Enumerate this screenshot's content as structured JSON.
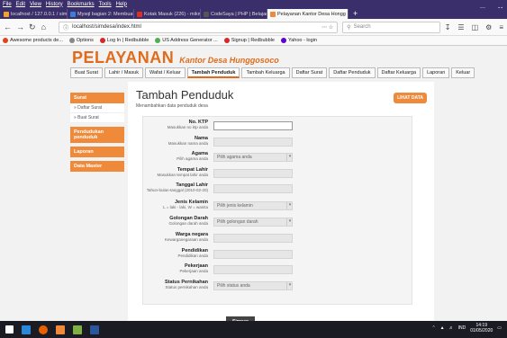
{
  "menu": [
    "File",
    "Edit",
    "View",
    "History",
    "Bookmarks",
    "Tools",
    "Help"
  ],
  "tabs": [
    {
      "label": "localhost / 127.0.0.1 / simdes",
      "color": "#f4a32a",
      "active": false
    },
    {
      "label": "Mysql bagian 2: Membuat ko",
      "color": "#3b7dd8",
      "active": false
    },
    {
      "label": "Kotak Masuk (226) - mikmaki",
      "color": "#d93025",
      "active": false
    },
    {
      "label": "CodeSaya | PHP | Belajar",
      "color": "#555555",
      "active": false
    },
    {
      "label": "Pelayanan Kantor Desa Hongg",
      "color": "#ef8a3a",
      "active": true
    }
  ],
  "url": "localhost/simdesa/index.html",
  "search_placeholder": "Search",
  "bookmarks": [
    {
      "label": "Awesome products de...",
      "color": "#e0441b"
    },
    {
      "label": "Options",
      "color": "#888888"
    },
    {
      "label": "Log In | Redbubble",
      "color": "#d62828"
    },
    {
      "label": "US Address Generator ...",
      "color": "#4caf50"
    },
    {
      "label": "Signup | Redbubble",
      "color": "#d62828"
    },
    {
      "label": "Yahoo - login",
      "color": "#6001d2"
    }
  ],
  "site": {
    "title": "PELAYANAN",
    "subtitle": "Kantor Desa Hunggosoco",
    "nav": [
      "Buat Surat",
      "Lahir / Masuk",
      "Wafat / Keluar",
      "Tambah Penduduk",
      "Tambah Keluarga",
      "Daftar Surat",
      "Daftar Penduduk",
      "Daftar Keluarga",
      "Laporan",
      "Keluar"
    ],
    "nav_active": 3
  },
  "sidebar": {
    "surat": "Surat",
    "surat_items": [
      "» Daftar Surat",
      "» Buat Surat"
    ],
    "pendudukan": "Pendudukan penduduk",
    "laporan": "Laporan",
    "data_master": "Data Master"
  },
  "main": {
    "heading": "Tambah Penduduk",
    "desc": "Menambahkan data penduduk desa",
    "lihat_data": "LIHAT DATA",
    "submit": "Simpan"
  },
  "fields": [
    {
      "label": "No. KTP",
      "hint": "Masukkan no ktp anda",
      "value": "",
      "type": "text",
      "focus": true
    },
    {
      "label": "Nama",
      "hint": "Masukkan nama anda",
      "value": "",
      "type": "text"
    },
    {
      "label": "Agama",
      "hint": "Pilih agama anda",
      "value": "Pilih agama anda",
      "type": "select"
    },
    {
      "label": "Tempat Lahir",
      "hint": "Masukkan tempat lahir anda",
      "value": "",
      "type": "text"
    },
    {
      "label": "Tanggal Lahir",
      "hint": "Tahun-bulan-tanggal (2010-02-20)",
      "value": "",
      "type": "text"
    },
    {
      "label": "Jenis Kelamin",
      "hint": "L = laki - laki, W = wanita",
      "value": "Pilih jenis kelamin",
      "type": "select"
    },
    {
      "label": "Golongan Darah",
      "hint": "Golongan darah anda",
      "value": "Pilih golongan darah",
      "type": "select"
    },
    {
      "label": "Warga negara",
      "hint": "Kewarganegaraan anda",
      "value": "",
      "type": "text"
    },
    {
      "label": "Pendidikan",
      "hint": "Pendidikan anda",
      "value": "",
      "type": "text"
    },
    {
      "label": "Pekerjaan",
      "hint": "Pekerjaan anda",
      "value": "",
      "type": "text"
    },
    {
      "label": "Status Pernikahan",
      "hint": "Status pernikahan anda",
      "value": "Pilih status anda",
      "type": "select"
    }
  ],
  "tray": {
    "lang": "IND",
    "time": "14:19",
    "date": "01/05/2020"
  },
  "colors": {
    "accent": "#ef8a3a",
    "firefox_chrome": "#3a2f6a"
  }
}
